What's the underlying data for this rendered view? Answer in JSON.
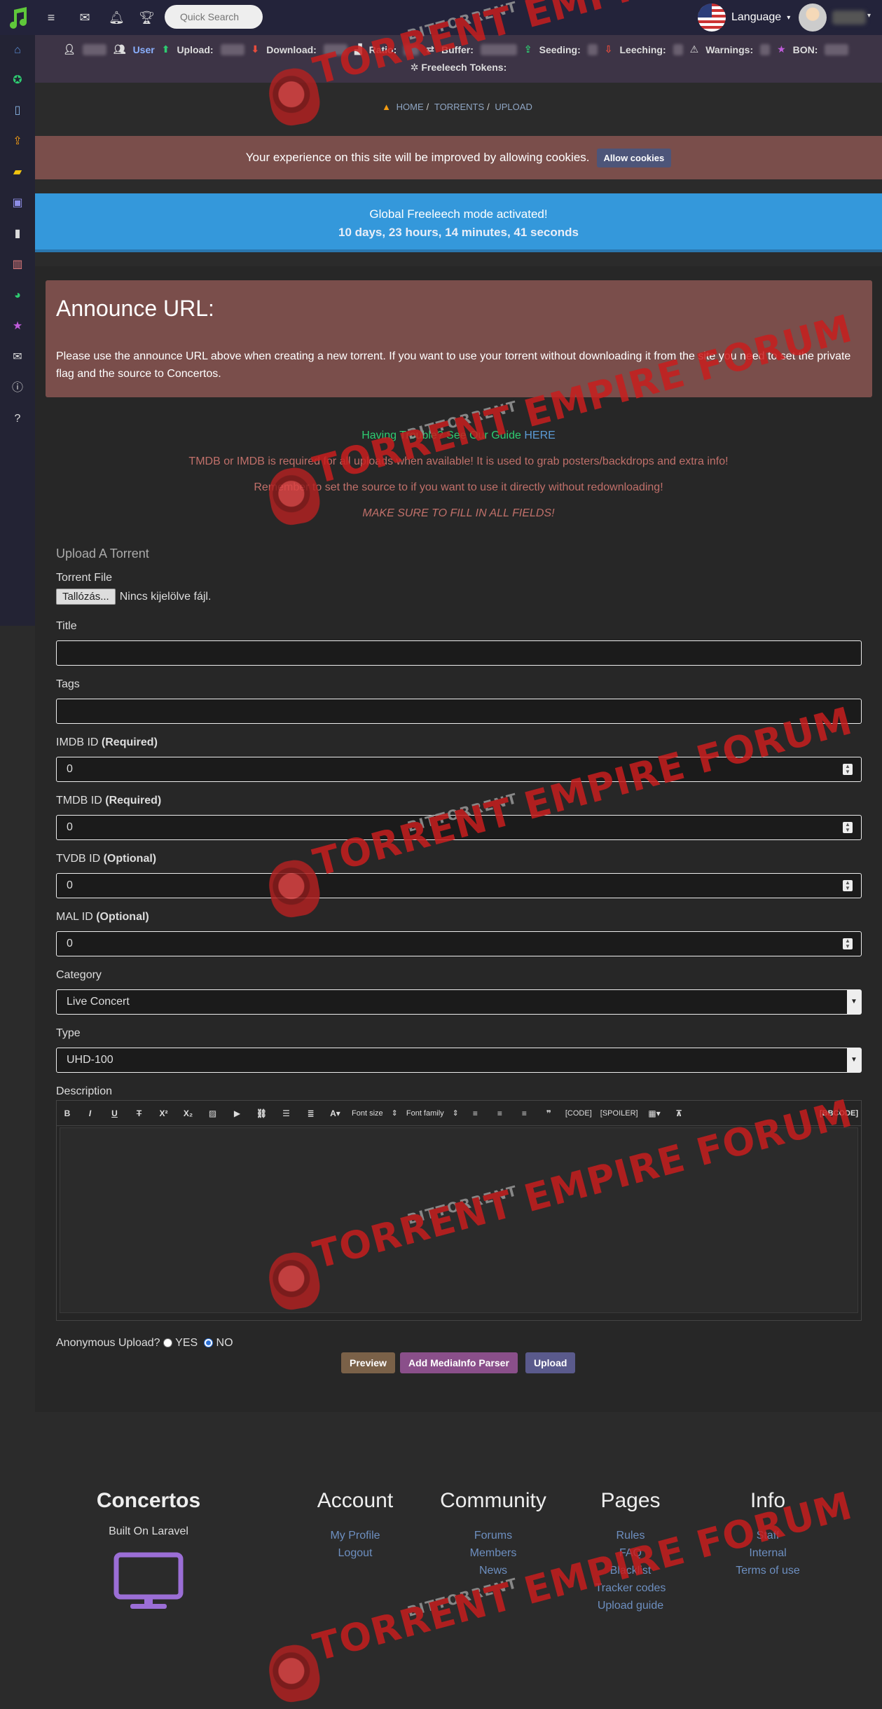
{
  "topbar": {
    "search_placeholder": "Quick Search",
    "language_label": "Language"
  },
  "stats": {
    "role": "User",
    "upload": "Upload:",
    "download": "Download:",
    "ratio": "Ratio:",
    "buffer": "Buffer:",
    "seeding": "Seeding:",
    "leeching": "Leeching:",
    "warnings": "Warnings:",
    "bon": "BON:",
    "freeleech_tokens": "Freeleech Tokens:"
  },
  "breadcrumb": [
    "Home",
    "Torrents",
    "Upload"
  ],
  "cookie": {
    "text": "Your experience on this site will be improved by allowing cookies.",
    "button": "Allow cookies"
  },
  "freeleech": {
    "line1": "Global Freeleech mode activated!",
    "line2": "10 days, 23 hours, 14 minutes, 41 seconds"
  },
  "announce": {
    "title": "Announce URL:",
    "text": "Please use the announce URL above when creating a new torrent. If you want to use your torrent without downloading it from the site you need to set the private flag and the source to Concertos."
  },
  "notes": {
    "guide": "Having Trouble? See Our Guide",
    "guide_link": "HERE",
    "tmdb": "TMDB or IMDB is required for all uploads when available! It is used to grab posters/backdrops and extra info!",
    "source": "Remember to set the source to if you want to use it directly without redownloading!",
    "fill": "MAKE SURE TO FILL IN ALL FIELDS!"
  },
  "form": {
    "heading": "Upload A Torrent",
    "torrent_file_label": "Torrent File",
    "browse_button": "Tallózás...",
    "no_file": "Nincs kijelölve fájl.",
    "title_label": "Title",
    "tags_label": "Tags",
    "imdb_label": "IMDB ID",
    "imdb_req": "(Required)",
    "imdb_value": "0",
    "tmdb_label": "TMDB ID",
    "tmdb_req": "(Required)",
    "tmdb_value": "0",
    "tvdb_label": "TVDB ID",
    "tvdb_req": "(Optional)",
    "tvdb_value": "0",
    "mal_label": "MAL ID",
    "mal_req": "(Optional)",
    "mal_value": "0",
    "category_label": "Category",
    "category_value": "Live Concert",
    "type_label": "Type",
    "type_value": "UHD-100",
    "description_label": "Description",
    "editor": {
      "font_size": "Font size",
      "font_family": "Font family",
      "code": "[CODE]",
      "spoiler": "[SPOILER]",
      "bbcode": "[BBCODE]"
    },
    "anonymous_label": "Anonymous Upload?",
    "yes": "YES",
    "no": "NO",
    "preview_button": "Preview",
    "mediainfo_button": "Add MediaInfo Parser",
    "upload_button": "Upload"
  },
  "footer": {
    "brand": "Concertos",
    "built_on": "Built On Laravel",
    "account_title": "Account",
    "account_links": [
      "My Profile",
      "Logout"
    ],
    "community_title": "Community",
    "community_links": [
      "Forums",
      "Members",
      "News"
    ],
    "pages_title": "Pages",
    "pages_links": [
      "Rules",
      "FAQ",
      "Blacklist",
      "Tracker codes",
      "Upload guide"
    ],
    "info_title": "Info",
    "info_links": [
      "Staff",
      "Internal",
      "Terms of use"
    ]
  },
  "watermark": {
    "big": "TORRENT EMPIRE FORUM",
    "small": "BITTORRENT"
  },
  "colors": {
    "accent_green": "#2ecc71",
    "announce_bg": "#7a4e4b",
    "freeleech_bg": "#3498db",
    "preview_btn": "#7a6148",
    "mediainfo_btn": "#8a4f8a",
    "upload_btn": "#5a5a8c",
    "link": "#6d8fc0"
  }
}
